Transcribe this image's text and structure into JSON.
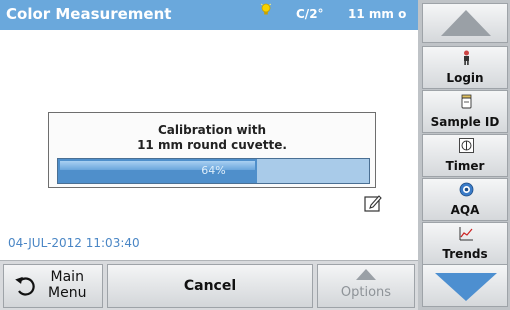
{
  "header": {
    "title": "Color Measurement",
    "parameter": "C/2°",
    "cuvette_size": "11 mm o"
  },
  "dialog": {
    "line1": "Calibration with",
    "line2": "11 mm round cuvette.",
    "progress_label": "64%",
    "progress_value": 0.64
  },
  "status": {
    "datetime": "04-JUL-2012 11:03:40"
  },
  "bottom_bar": {
    "main_menu_line1": "Main",
    "main_menu_line2": "Menu",
    "cancel_label": "Cancel",
    "options_label": "Options"
  },
  "sidebar": {
    "items": [
      {
        "label": "Login",
        "icon": "person-icon"
      },
      {
        "label": "Sample ID",
        "icon": "sample-bottle-icon"
      },
      {
        "label": "Timer",
        "icon": "timer-icon"
      },
      {
        "label": "AQA",
        "icon": "aqa-icon"
      },
      {
        "label": "Trends",
        "icon": "trends-icon"
      }
    ]
  },
  "colors": {
    "title_bar": "#6aa8dc",
    "progress_fill": "#4f8fcb",
    "datetime_text": "#4a86c5"
  }
}
